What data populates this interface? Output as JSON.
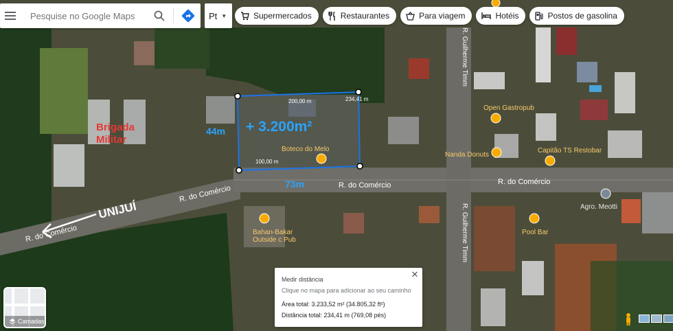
{
  "search": {
    "placeholder": "Pesquise no Google Maps"
  },
  "language": {
    "label": "Pt"
  },
  "chips": [
    {
      "label": "Supermercados",
      "icon": "cart-icon"
    },
    {
      "label": "Restaurantes",
      "icon": "fork-knife-icon"
    },
    {
      "label": "Para viagem",
      "icon": "takeout-icon"
    },
    {
      "label": "Hotéis",
      "icon": "bed-icon"
    },
    {
      "label": "Postos de gasolina",
      "icon": "gas-pump-icon"
    }
  ],
  "map": {
    "streets": {
      "comercio_1": "R. do Comércio",
      "comercio_2": "R. do Comércio",
      "comercio_3": "R. do Comércio",
      "comercio_4": "R. do Comércio",
      "guilherme_1": "R. Guilherme Timm",
      "guilherme_2": "R. Guilherme Timm"
    },
    "places": {
      "open_gastropub": "Open Gastropub",
      "capitao": "Capitão TS Restobar",
      "nanda": "Nanda Donuts",
      "boteco": "Boteco do Melo",
      "agro": "Agro. Meotti",
      "pool": "Pool Bar",
      "bahan_1": "Bahan-Bakar",
      "bahan_2": "Outside c Pub"
    },
    "annotations": {
      "brigada_1": "Brigada",
      "brigada_2": "Militar",
      "unijui": "UNIJUÍ",
      "area": "+ 3.200m²",
      "side_left": "44m",
      "side_bottom": "73m"
    },
    "measure_labels": {
      "top": "200,00 m",
      "top_right": "234,41 m",
      "bottom": "100,00 m"
    },
    "colors": {
      "measure": "#1a73e8",
      "annotation_red": "#e53935",
      "annotation_blue": "#29a3ff",
      "pin": "#f9ab00"
    }
  },
  "layers": {
    "label": "Camadas"
  },
  "measure_panel": {
    "title": "Medir distância",
    "hint": "Clique no mapa para adicionar ao seu caminho",
    "area": "Área total: 3.233,52 m² (34.805,32 ft²)",
    "distance": "Distância total: 234,41 m (769,08 pés)"
  }
}
